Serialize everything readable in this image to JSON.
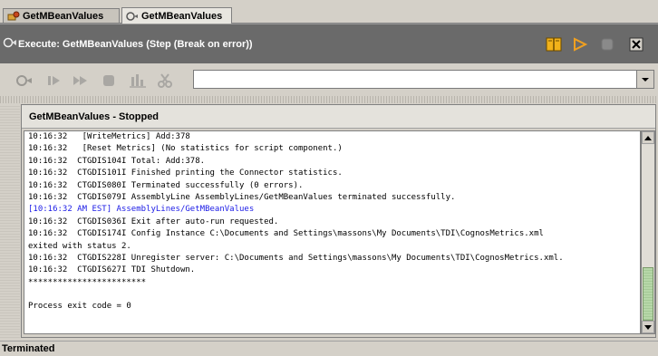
{
  "tabs": [
    {
      "label": "GetMBeanValues",
      "active": false
    },
    {
      "label": "GetMBeanValues",
      "active": true
    }
  ],
  "exec": {
    "title": "Execute: GetMBeanValues (Step (Break on error))",
    "buttons": [
      "book-icon",
      "run-icon",
      "stop-icon",
      "close-icon"
    ]
  },
  "toolbar": {
    "icons": [
      "connector-icon",
      "step-icon",
      "step-over-icon",
      "stop-icon",
      "chart-icon",
      "cut-icon"
    ],
    "combo_value": ""
  },
  "panel": {
    "title": "GetMBeanValues - Stopped"
  },
  "log": {
    "lines": [
      {
        "text": "10:16:32   [WriteMetrics] Add:378",
        "blue": false
      },
      {
        "text": "10:16:32   [Reset Metrics] (No statistics for script component.)",
        "blue": false
      },
      {
        "text": "10:16:32  CTGDIS104I Total: Add:378.",
        "blue": false
      },
      {
        "text": "10:16:32  CTGDIS101I Finished printing the Connector statistics.",
        "blue": false
      },
      {
        "text": "10:16:32  CTGDIS080I Terminated successfully (0 errors).",
        "blue": false
      },
      {
        "text": "10:16:32  CTGDIS079I AssemblyLine AssemblyLines/GetMBeanValues terminated successfully.",
        "blue": false
      },
      {
        "text": "[10:16:32 AM EST] AssemblyLines/GetMBeanValues",
        "blue": true
      },
      {
        "text": "10:16:32  CTGDIS036I Exit after auto-run requested.",
        "blue": false
      },
      {
        "text": "10:16:32  CTGDIS174I Config Instance C:\\Documents and Settings\\massons\\My Documents\\TDI\\CognosMetrics.xml",
        "blue": false
      },
      {
        "text": "exited with status 2.",
        "blue": false
      },
      {
        "text": "10:16:32  CTGDIS228I Unregister server: C:\\Documents and Settings\\massons\\My Documents\\TDI\\CognosMetrics.xml.",
        "blue": false
      },
      {
        "text": "10:16:32  CTGDIS627I TDI Shutdown.",
        "blue": false
      },
      {
        "text": "************************",
        "blue": false
      },
      {
        "text": "",
        "blue": false
      },
      {
        "text": "Process exit code = 0",
        "blue": false
      }
    ]
  },
  "status": {
    "text": "Terminated"
  },
  "colors": {
    "exec_bar": "#6a6a6a",
    "log_blue": "#1a1ae6",
    "scroll_thumb": "#b6d7a8"
  }
}
